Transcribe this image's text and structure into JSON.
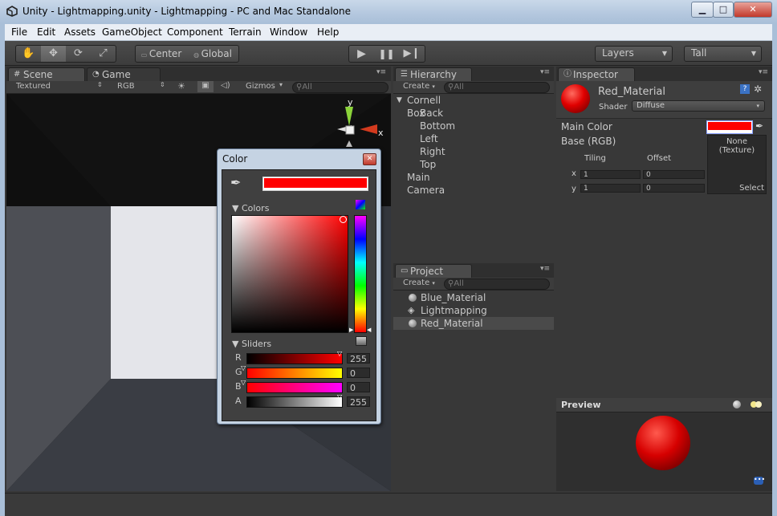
{
  "window": {
    "title": "Unity - Lightmapping.unity - Lightmapping - PC and Mac Standalone",
    "minimize": "▁",
    "maximize": "□",
    "close": "✕"
  },
  "menu": [
    "File",
    "Edit",
    "Assets",
    "GameObject",
    "Component",
    "Terrain",
    "Window",
    "Help"
  ],
  "toolbar": {
    "tools": [
      "hand-icon",
      "move-icon",
      "rotate-icon",
      "scale-icon"
    ],
    "pivot_center": "Center",
    "pivot_global": "Global",
    "layers": "Layers",
    "layout": "Tall"
  },
  "scene": {
    "tab_scene": "Scene",
    "tab_game": "Game",
    "render_mode": "Textured",
    "color_mode": "RGB",
    "gizmos": "Gizmos",
    "search_placeholder": "All",
    "gizmo_y": "y",
    "gizmo_x": "x"
  },
  "hierarchy": {
    "tab": "Hierarchy",
    "create": "Create",
    "search_placeholder": "All",
    "items": [
      {
        "label": "Cornell Box",
        "indent": 0,
        "expanded": true
      },
      {
        "label": "Back",
        "indent": 1
      },
      {
        "label": "Bottom",
        "indent": 1
      },
      {
        "label": "Left",
        "indent": 1
      },
      {
        "label": "Right",
        "indent": 1
      },
      {
        "label": "Top",
        "indent": 1
      },
      {
        "label": "Main Camera",
        "indent": 0
      }
    ]
  },
  "project": {
    "tab": "Project",
    "create": "Create",
    "search_placeholder": "All",
    "items": [
      {
        "label": "Blue_Material",
        "icon": "material-sphere-icon",
        "selected": false
      },
      {
        "label": "Lightmapping",
        "icon": "unity-scene-icon",
        "selected": false
      },
      {
        "label": "Red_Material",
        "icon": "material-sphere-icon",
        "selected": true
      }
    ]
  },
  "inspector": {
    "tab": "Inspector",
    "material_name": "Red_Material",
    "shader_label": "Shader",
    "shader_value": "Diffuse",
    "main_color_label": "Main Color",
    "main_color": "#ff0000",
    "base_label": "Base (RGB)",
    "tiling_label": "Tiling",
    "offset_label": "Offset",
    "x_label": "x",
    "y_label": "y",
    "tiling_x": "1",
    "tiling_y": "1",
    "offset_x": "0",
    "offset_y": "0",
    "texture_none": "None\n(Texture)",
    "texture_select": "Select",
    "preview_label": "Preview"
  },
  "color_picker": {
    "title": "Color",
    "current_color": "#ff0000",
    "colors_label": "Colors",
    "sliders_label": "Sliders",
    "channels": [
      {
        "name": "R",
        "value": "255",
        "fraction": 1.0
      },
      {
        "name": "G",
        "value": "0",
        "fraction": 0.0
      },
      {
        "name": "B",
        "value": "0",
        "fraction": 0.0
      },
      {
        "name": "A",
        "value": "255",
        "fraction": 1.0
      }
    ]
  },
  "colors": {
    "accent": "#ff0000",
    "panel": "#383838",
    "selected_row": "#4a4a4a"
  }
}
